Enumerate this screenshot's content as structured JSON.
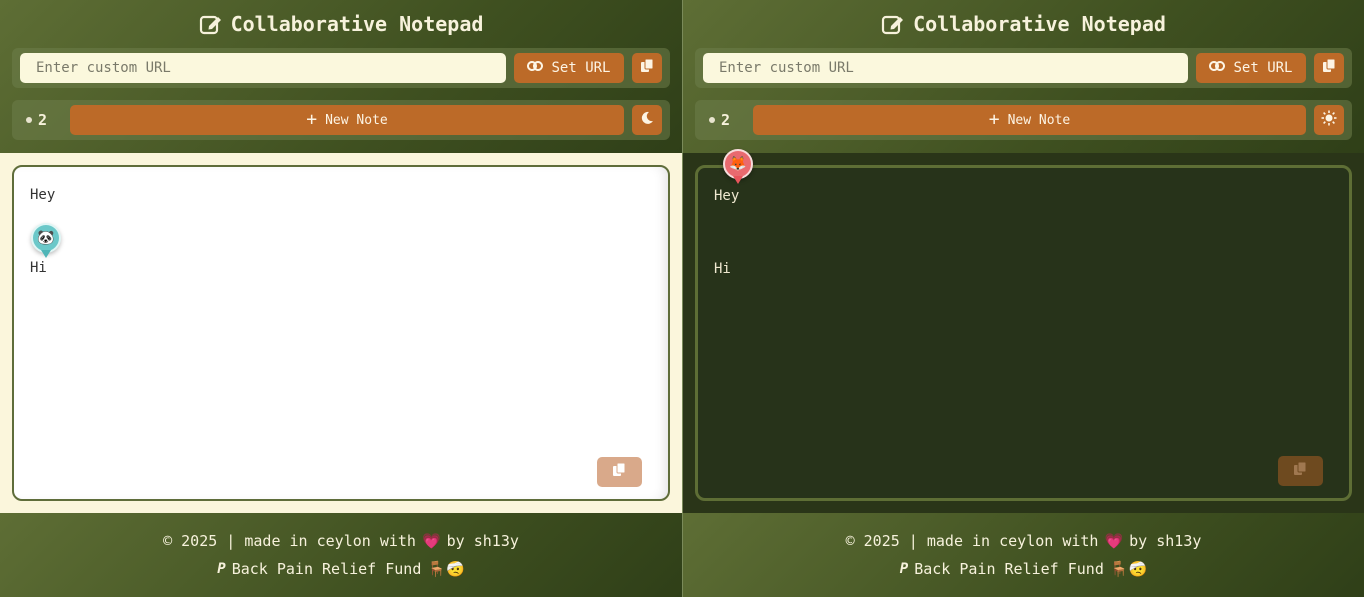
{
  "app": {
    "title": "Collaborative Notepad"
  },
  "url_bar": {
    "placeholder": "Enter custom URL",
    "set_url_label": "Set URL"
  },
  "toolbar": {
    "user_count": "2",
    "new_note_label": "New Note",
    "theme_toggle_left": "moon-icon",
    "theme_toggle_right": "sun-icon"
  },
  "note": {
    "lines": [
      "Hey",
      "Hi"
    ]
  },
  "cursors": {
    "left_avatar": "🐼",
    "right_avatar": "🦊"
  },
  "footer": {
    "line1_prefix": "© 2025 | made in ceylon with",
    "heart": "💗",
    "line1_suffix": "by sh13y",
    "fund_label": "Back Pain Relief Fund",
    "fund_emojis": "🪑🤕"
  },
  "colors": {
    "accent": "#bc6a28",
    "header_bg": "#4a5a28",
    "light_editor_bg": "#ffffff",
    "dark_editor_bg": "#27331a"
  }
}
